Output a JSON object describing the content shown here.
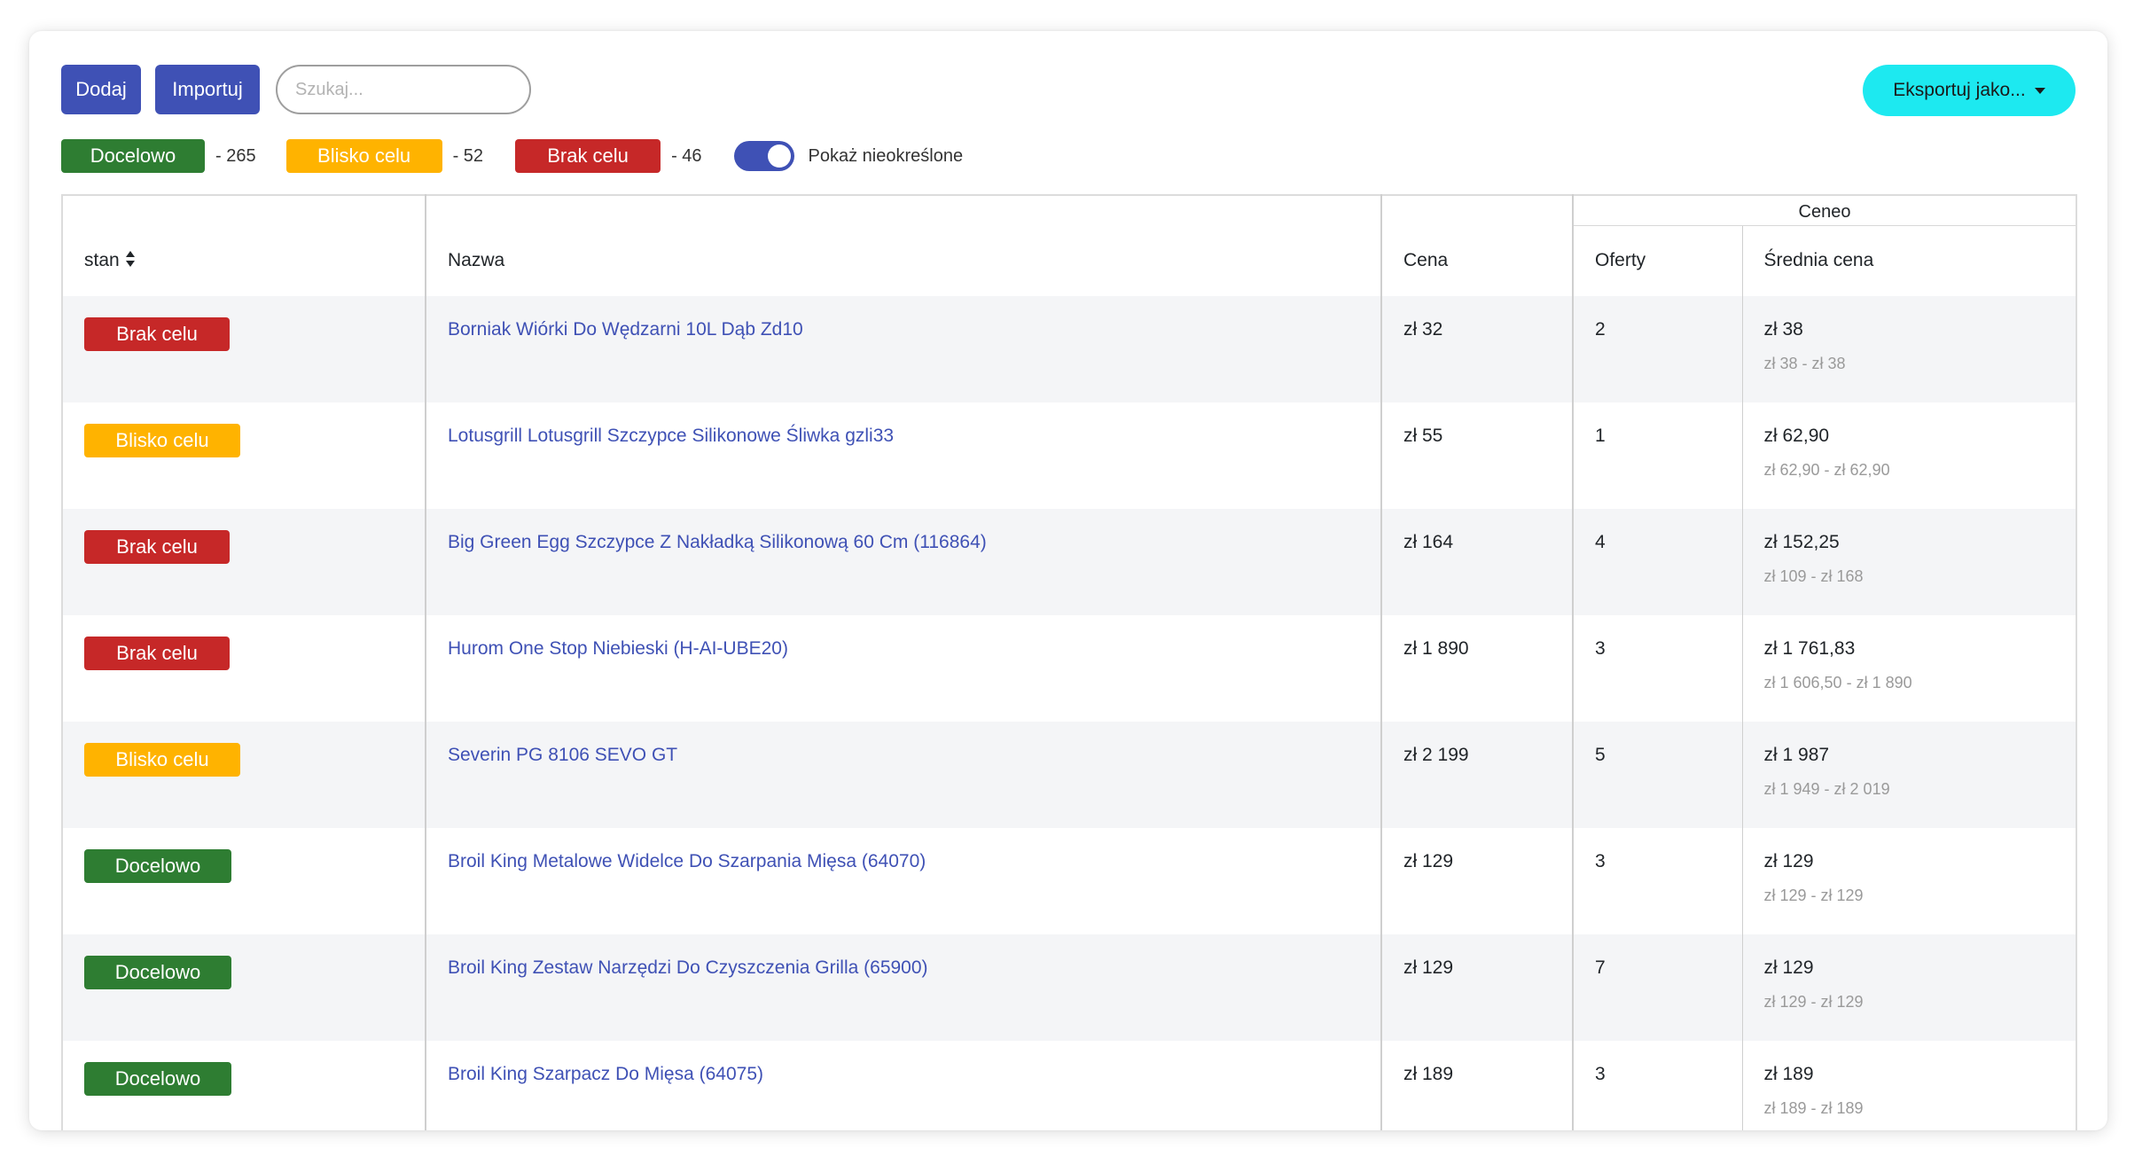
{
  "toolbar": {
    "add_label": "Dodaj",
    "import_label": "Importuj",
    "search_placeholder": "Szukaj...",
    "search_icon": "search-icon",
    "export_label": "Eksportuj jako..."
  },
  "legend": {
    "docelowo": {
      "label": "Docelowo",
      "count": "- 265",
      "color": "#2e7d32"
    },
    "blisko": {
      "label": "Blisko celu",
      "count": "- 52",
      "color": "#ffb300"
    },
    "brak": {
      "label": "Brak celu",
      "count": "- 46",
      "color": "#c62828"
    },
    "toggle_label": "Pokaż nieokreślone",
    "toggle_on": true
  },
  "table": {
    "headers": {
      "stan": "stan",
      "nazwa": "Nazwa",
      "cena": "Cena",
      "group": "Ceneo",
      "oferty": "Oferty",
      "srednia": "Średnia cena"
    },
    "rows": [
      {
        "stan": "Brak celu",
        "status": "red",
        "name": "Borniak Wiórki Do Wędzarni 10L Dąb Zd10",
        "price": "zł 32",
        "offers": "2",
        "avg": "zł 38",
        "range": "zł 38 - zł 38"
      },
      {
        "stan": "Blisko celu",
        "status": "orange",
        "name": "Lotusgrill Lotusgrill Szczypce Silikonowe Śliwka gzli33",
        "price": "zł 55",
        "offers": "1",
        "avg": "zł 62,90",
        "range": "zł 62,90 - zł 62,90"
      },
      {
        "stan": "Brak celu",
        "status": "red",
        "name": "Big Green Egg Szczypce Z Nakładką Silikonową 60 Cm (116864)",
        "price": "zł 164",
        "offers": "4",
        "avg": "zł 152,25",
        "range": "zł 109 - zł 168"
      },
      {
        "stan": "Brak celu",
        "status": "red",
        "name": "Hurom One Stop Niebieski (H-AI-UBE20)",
        "price": "zł 1 890",
        "offers": "3",
        "avg": "zł 1 761,83",
        "range": "zł 1 606,50 - zł 1 890"
      },
      {
        "stan": "Blisko celu",
        "status": "orange",
        "name": "Severin PG 8106 SEVO GT",
        "price": "zł 2 199",
        "offers": "5",
        "avg": "zł 1 987",
        "range": "zł 1 949 - zł 2 019"
      },
      {
        "stan": "Docelowo",
        "status": "green",
        "name": "Broil King Metalowe Widelce Do Szarpania Mięsa (64070)",
        "price": "zł 129",
        "offers": "3",
        "avg": "zł 129",
        "range": "zł 129 - zł 129"
      },
      {
        "stan": "Docelowo",
        "status": "green",
        "name": "Broil King Zestaw Narzędzi Do Czyszczenia Grilla (65900)",
        "price": "zł 129",
        "offers": "7",
        "avg": "zł 129",
        "range": "zł 129 - zł 129"
      },
      {
        "stan": "Docelowo",
        "status": "green",
        "name": "Broil King Szarpacz Do Mięsa (64075)",
        "price": "zł 189",
        "offers": "3",
        "avg": "zł 189",
        "range": "zł 189 - zł 189"
      }
    ]
  }
}
